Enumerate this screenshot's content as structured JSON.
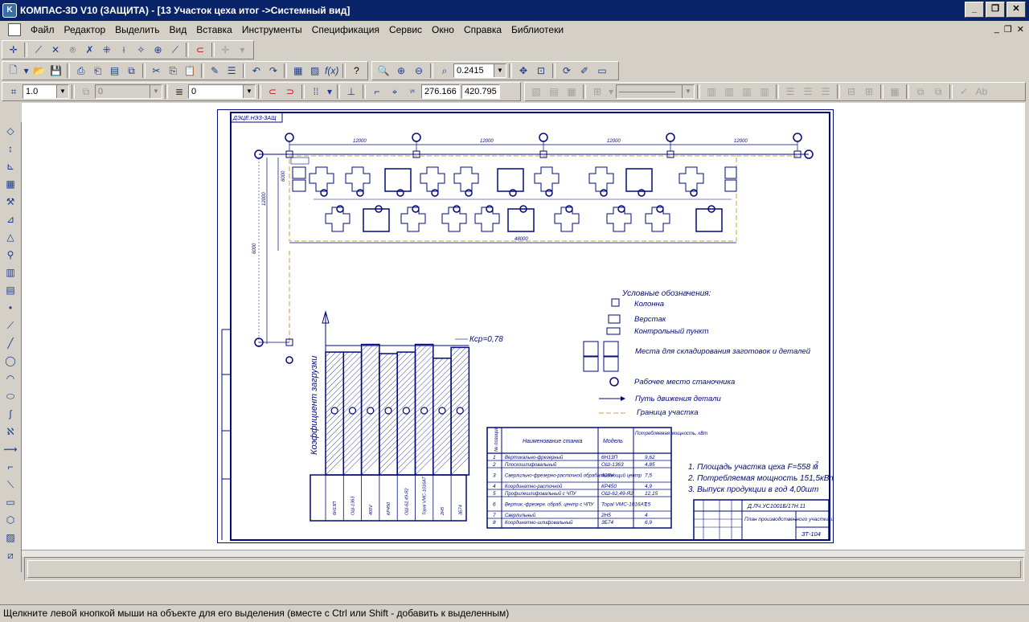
{
  "window": {
    "title": "КОМПАС-3D V10 (ЗАЩИТА) - [13 Участок цеха итог ->Системный вид]",
    "app_icon": "K",
    "buttons": [
      "_",
      "❐",
      "✕"
    ]
  },
  "menu": {
    "items": [
      "Файл",
      "Редактор",
      "Выделить",
      "Вид",
      "Вставка",
      "Инструменты",
      "Спецификация",
      "Сервис",
      "Окно",
      "Справка",
      "Библиотеки"
    ],
    "mdi_buttons": [
      "_",
      "❐",
      "✕"
    ]
  },
  "toolbar_view": {
    "zoom_value": "0.2415"
  },
  "toolbar_props": {
    "line_scale": "1.0",
    "layer_value": "0",
    "state_value": "0",
    "coord_x": "276.166",
    "coord_y": "420.795"
  },
  "drawing": {
    "stamp_code": "ДЭЦЕ.НЭЗ-ЗАЩ",
    "legend_title": "Условные обозначения:",
    "legend": [
      "Колонна",
      "Верстак",
      "Контрольный пункт",
      "Места для складирования заготовок и деталей",
      "Рабочее место станочника",
      "Путь движения детали",
      "Граница участка"
    ],
    "k_label": "Кср=0,78",
    "y_axis_label": "Коэффициент загрузки",
    "notes": [
      "1. Площадь участка цеха F=558 м",
      "2. Потребляемая мощность 151,5кВт",
      "3. Выпуск продукции в год 4,00шт"
    ],
    "table_headers": [
      "№ позиции",
      "Наименование станка",
      "Модель",
      "Потребляемая мощность, кВт"
    ],
    "table_rows": [
      [
        "1",
        "Вертикально-фрезерный",
        "6Н13П",
        "9,62"
      ],
      [
        "2",
        "Плоскошлифовальный",
        "ОШ-1363",
        "4,85"
      ],
      [
        "3",
        "Сверлильно-фрезерно-расточной обрабатывающий центр",
        "400V",
        "7,5"
      ],
      [
        "4",
        "Координатно-расточной",
        "КР450",
        "4,9"
      ],
      [
        "5",
        "Профилешлифовальный с ЧПУ",
        "ОШ-62,49-Я2",
        "12,15"
      ],
      [
        "6",
        "Вертик.-фрезерн. обраб. центр с ЧПУ",
        "Topal VMC-1016AT",
        "15"
      ],
      [
        "7",
        "Сверлильный",
        "2Н5",
        "4"
      ],
      [
        "8",
        "Координатно-шлифовальный",
        "3Б74",
        "6,9"
      ]
    ],
    "stamp_title": "План производственного участка цеха",
    "stamp_doc": "Д.ЛЧ.УС1001Б/17Н.11",
    "stamp_sheet": "ЗТ-104",
    "dims": [
      "12000",
      "12000",
      "12000",
      "12000",
      "12000",
      "6000",
      "48000",
      "6000"
    ]
  },
  "chart_data": {
    "type": "bar",
    "categories": [
      "6Н13П",
      "ОШ-1363",
      "400V",
      "КР450",
      "ОШ-62,49-Я2",
      "Topal VMC-1016AT",
      "2Н5",
      "3Б74"
    ],
    "values": [
      0.8,
      0.8,
      0.85,
      0.79,
      0.8,
      0.85,
      0.76,
      0.83
    ],
    "ylabel": "Коэффициент загрузки",
    "mean_label": "Кср=0,78"
  },
  "status": {
    "hint": "Щелкните левой кнопкой мыши на объекте для его выделения (вместе с Ctrl или Shift - добавить к выделенным)"
  },
  "colors": {
    "titlebar": "#0a246a",
    "drawing": "#000a7a",
    "boundary": "#d4a040"
  }
}
